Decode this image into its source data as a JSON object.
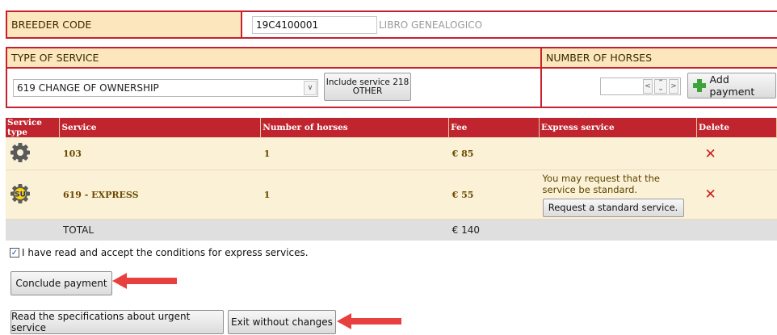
{
  "breeder": {
    "label": "BREEDER CODE",
    "code": "19C4100001",
    "registry": "LIBRO GENEALOGICO"
  },
  "service_section": {
    "type_header": "TYPE OF SERVICE",
    "horses_header": "NUMBER OF HORSES",
    "selected_service": "619 CHANGE OF OWNERSHIP",
    "include_line1": "Include service 218",
    "include_line2": "OTHER",
    "add_payment_label": "Add payment",
    "horses_value": ""
  },
  "table": {
    "headers": [
      "Service type",
      "Service",
      "Number of horses",
      "Fee",
      "Express service",
      "Delete"
    ],
    "rows": [
      {
        "icon": "gear-icon",
        "service": "103",
        "horses": "1",
        "fee": "€ 85",
        "express": ""
      },
      {
        "icon": "gear-su-icon",
        "icon_text": "SU",
        "service": "619 - EXPRESS",
        "horses": "1",
        "fee": "€ 55",
        "express": "You may request that the service be standard.",
        "express_button": "Request a standard service."
      }
    ],
    "total_label": "TOTAL",
    "total_value": "€ 140"
  },
  "accept_label": "I have read and accept the conditions for express services.",
  "buttons": {
    "conclude": "Conclude payment",
    "read_specs": "Read the specifications about urgent service",
    "exit": "Exit without changes"
  },
  "colors": {
    "accent": "#c0242f",
    "header_bg": "#fbe6bd",
    "row_bg": "#fbf1d6",
    "arrow": "#e8403e"
  }
}
